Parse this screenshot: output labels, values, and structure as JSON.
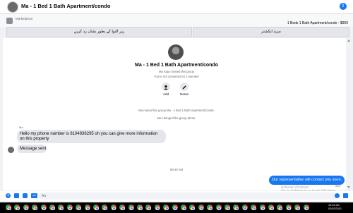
{
  "header": {
    "title": "Ma - 1 Bed 1 Bath Apartment/condo",
    "info_glyph": "i"
  },
  "marketplace": {
    "label": "Marketplace",
    "listing": "1 Beds 1 Bath Apartment/condo - $900"
  },
  "actions": {
    "mark_pending": "زیر التوا کے بطور نشان زد کریں",
    "more_actions": "مزید ایکشنز"
  },
  "group": {
    "title": "Ma - 1 Bed 1 Bath Apartment/condo",
    "created_by": "Ma Kaja created this group",
    "not_connected": "You're not connected to 1 member",
    "add_label": "Add",
    "name_label": "Name",
    "system_msg_1": "Ma named the group Ma - 1 Bed 1 Bath Apartment/condo.",
    "system_msg_2": "Ma changed the group photo."
  },
  "messages": {
    "sender": "Ma",
    "msg1": "Hello my phone number is 8104936295 oh you can give more information on this property",
    "msg2": "Message sent",
    "timestamp": "09:43 AM",
    "outgoing": "Our representative will contact you soon.",
    "sent_status": "Sent"
  },
  "composer": {
    "placeholder": "Aa",
    "plus_glyph": "+",
    "gif_glyph": "GIF"
  },
  "watermark": {
    "line1": "Activate Windows",
    "line2": "Go to Settings to activate Windows."
  },
  "taskbar": {
    "time": "10:44 am",
    "date": "02/02/2021",
    "icons": [
      "chrome",
      "chrome",
      "chrome",
      "chrome",
      "chrome",
      "chrome",
      "chrome",
      "chrome",
      "chrome",
      "chrome",
      "chrome",
      "chrome",
      "chrome",
      "chrome",
      "chrome",
      "chrome",
      "chrome",
      "chrome",
      "chrome",
      "chrome",
      "chrome",
      "chrome",
      "chrome",
      "chrome",
      "chrome",
      "chrome",
      "chrome",
      "chrome",
      "chrome",
      "chrome",
      "chrome",
      "chrome",
      "chrome",
      "chrome",
      "chrome"
    ]
  },
  "colors": {
    "accent": "#1877f2",
    "bubble_in": "#e4e6eb",
    "taskbar": "#000000"
  }
}
